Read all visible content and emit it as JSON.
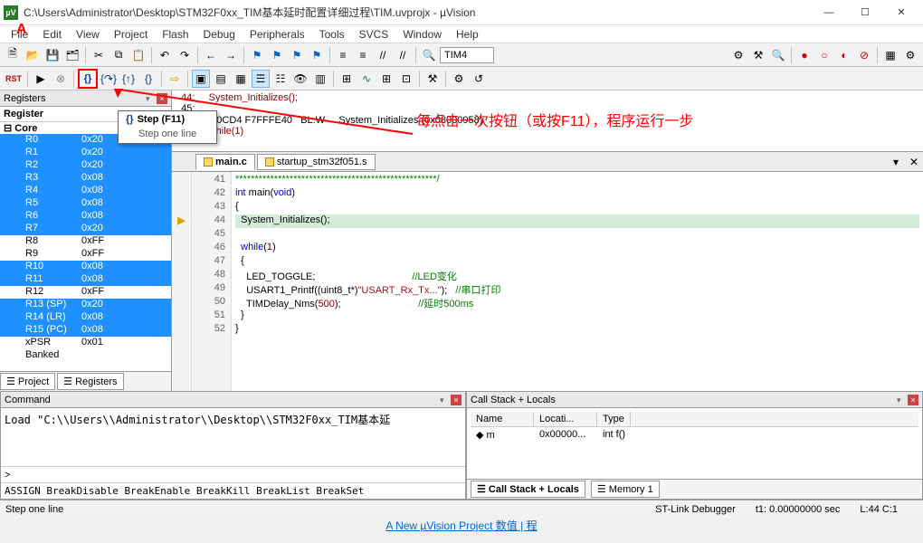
{
  "window": {
    "title": "C:\\Users\\Administrator\\Desktop\\STM32F0xx_TIM基本延时配置详细过程\\TIM.uvprojx - µVision",
    "min": "—",
    "max": "☐",
    "close": "✕"
  },
  "menus": [
    "File",
    "Edit",
    "View",
    "Project",
    "Flash",
    "Debug",
    "Peripherals",
    "Tools",
    "SVCS",
    "Window",
    "Help"
  ],
  "toolbar": {
    "target": "TIM4"
  },
  "tooltip": {
    "title": "Step (F11)",
    "sub": "Step one line"
  },
  "annotation": "每点击一次按钮（或按F11），程序运行一步",
  "registers": {
    "title": "Registers",
    "col_name": "Register",
    "root": "Core",
    "rows": [
      {
        "n": "R0",
        "v": "0x20",
        "sel": true
      },
      {
        "n": "R1",
        "v": "0x20",
        "sel": true
      },
      {
        "n": "R2",
        "v": "0x20",
        "sel": true
      },
      {
        "n": "R3",
        "v": "0x08",
        "sel": true
      },
      {
        "n": "R4",
        "v": "0x08",
        "sel": true
      },
      {
        "n": "R5",
        "v": "0x08",
        "sel": true
      },
      {
        "n": "R6",
        "v": "0x08",
        "sel": true
      },
      {
        "n": "R7",
        "v": "0x20",
        "sel": true
      },
      {
        "n": "R8",
        "v": "0xFF",
        "sel": false
      },
      {
        "n": "R9",
        "v": "0xFF",
        "sel": false
      },
      {
        "n": "R10",
        "v": "0x08",
        "sel": true
      },
      {
        "n": "R11",
        "v": "0x08",
        "sel": true
      },
      {
        "n": "R12",
        "v": "0xFF",
        "sel": false
      },
      {
        "n": "R13 (SP)",
        "v": "0x20",
        "sel": true
      },
      {
        "n": "R14 (LR)",
        "v": "0x08",
        "sel": true
      },
      {
        "n": "R15 (PC)",
        "v": "0x08",
        "sel": true
      },
      {
        "n": "xPSR",
        "v": "0x01",
        "sel": false
      },
      {
        "n": "Banked",
        "v": "",
        "sel": false
      }
    ],
    "tabs": [
      "Project",
      "Registers"
    ]
  },
  "disasm": {
    "l1": "  44:     System_Initializes();",
    "l2": "  45:  ",
    "l3_addr": "0x08000CD4 F7FFFE40   BL.W     System_Initializes (0x08000958)",
    "l4": "  46:     while(1)"
  },
  "filetabs": [
    {
      "name": "main.c",
      "active": true
    },
    {
      "name": "startup_stm32f051.s",
      "active": false
    }
  ],
  "editor": {
    "lines": [
      {
        "n": 41,
        "html": "<span class='cmt'>****************************************************/</span>"
      },
      {
        "n": 42,
        "html": "<span class='kw'>int</span> main(<span class='kw'>void</span>)"
      },
      {
        "n": 43,
        "html": "{"
      },
      {
        "n": 44,
        "html": "  System_Initializes();",
        "cur": true,
        "arrow": true
      },
      {
        "n": 45,
        "html": ""
      },
      {
        "n": 46,
        "html": "  <span class='kw'>while</span>(<span class='num'>1</span>)"
      },
      {
        "n": 47,
        "html": "  {"
      },
      {
        "n": 48,
        "html": "    LED_TOGGLE;                                   <span class='cmt'>//LED变化</span>"
      },
      {
        "n": 49,
        "html": "    USART1_Printf((uint8_t*)<span class='str'>\"USART_Rx_Tx...\"</span>);   <span class='cmt'>//串口打印</span>"
      },
      {
        "n": 50,
        "html": "    TIMDelay_Nms(<span class='num'>500</span>);                            <span class='cmt'>//延时500ms</span>"
      },
      {
        "n": 51,
        "html": "  }"
      },
      {
        "n": 52,
        "html": "}"
      }
    ]
  },
  "command": {
    "title": "Command",
    "body": "Load \"C:\\\\Users\\\\Administrator\\\\Desktop\\\\STM32F0xx_TIM基本延",
    "prompt": ">",
    "hints": "ASSIGN BreakDisable BreakEnable BreakKill BreakList BreakSet"
  },
  "callstack": {
    "title": "Call Stack + Locals",
    "cols": [
      "Name",
      "Locati...",
      "Type"
    ],
    "row": {
      "name": "m",
      "loc": "0x00000...",
      "type": "int f()"
    },
    "tabs": [
      "Call Stack + Locals",
      "Memory 1"
    ]
  },
  "statusbar": {
    "l": "Step one line",
    "dbg": "ST-Link Debugger",
    "t1": "t1: 0.00000000 sec",
    "pos": "L:44 C:1"
  },
  "footer_link": "A New µVision Project 数值 | 程"
}
